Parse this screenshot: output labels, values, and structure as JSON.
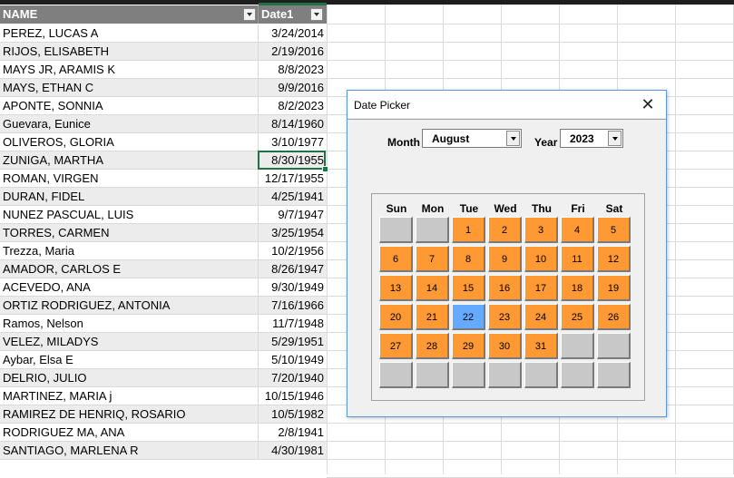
{
  "sheet": {
    "headers": {
      "name": "NAME",
      "date": "Date1"
    },
    "rows": [
      {
        "name": "PEREZ, LUCAS A",
        "date": "3/24/2014"
      },
      {
        "name": "RIJOS, ELISABETH",
        "date": "2/19/2016"
      },
      {
        "name": "MAYS JR, ARAMIS K",
        "date": "8/8/2023"
      },
      {
        "name": "MAYS, ETHAN C",
        "date": "9/9/2016"
      },
      {
        "name": "APONTE, SONNIA",
        "date": "8/2/2023"
      },
      {
        "name": "Guevara, Eunice",
        "date": "8/14/1960"
      },
      {
        "name": "OLIVEROS, GLORIA",
        "date": "3/10/1977"
      },
      {
        "name": "ZUNIGA, MARTHA",
        "date": "8/30/1955"
      },
      {
        "name": "ROMAN, VIRGEN",
        "date": "12/17/1955"
      },
      {
        "name": "DURAN, FIDEL",
        "date": "4/25/1941"
      },
      {
        "name": "NUNEZ PASCUAL, LUIS",
        "date": "9/7/1947"
      },
      {
        "name": "TORRES, CARMEN",
        "date": "3/25/1954"
      },
      {
        "name": "Trezza, Maria",
        "date": "10/2/1956"
      },
      {
        "name": "AMADOR, CARLOS E",
        "date": "8/26/1947"
      },
      {
        "name": "ACEVEDO, ANA",
        "date": "9/30/1949"
      },
      {
        "name": "ORTIZ RODRIGUEZ, ANTONIA",
        "date": "7/16/1966"
      },
      {
        "name": "Ramos, Nelson",
        "date": "11/7/1948"
      },
      {
        "name": "VELEZ, MILADYS",
        "date": "5/29/1951"
      },
      {
        "name": "Aybar, Elsa E",
        "date": "5/10/1949"
      },
      {
        "name": "DELRIO, JULIO",
        "date": "7/20/1940"
      },
      {
        "name": "MARTINEZ, MARIA j",
        "date": "10/15/1946"
      },
      {
        "name": "RAMIREZ DE HENRIQ, ROSARIO",
        "date": "10/5/1982"
      },
      {
        "name": "RODRIGUEZ MA, ANA",
        "date": "2/8/1941"
      },
      {
        "name": "SANTIAGO, MARLENA R",
        "date": "4/30/1981"
      }
    ],
    "selected_row": 7,
    "colors": {
      "header_bg": "#7f7f7f",
      "band": "#ececec",
      "selection": "#217346"
    }
  },
  "dialog": {
    "title": "Date Picker",
    "close_icon": "close-icon",
    "month_label": "Month",
    "month_value": "August",
    "year_label": "Year",
    "year_value": "2023",
    "weekdays": [
      "Sun",
      "Mon",
      "Tue",
      "Wed",
      "Thu",
      "Fri",
      "Sat"
    ],
    "weeks": [
      [
        "",
        "",
        "1",
        "2",
        "3",
        "4",
        "5"
      ],
      [
        "6",
        "7",
        "8",
        "9",
        "10",
        "11",
        "12"
      ],
      [
        "13",
        "14",
        "15",
        "16",
        "17",
        "18",
        "19"
      ],
      [
        "20",
        "21",
        "22",
        "23",
        "24",
        "25",
        "26"
      ],
      [
        "27",
        "28",
        "29",
        "30",
        "31",
        "",
        ""
      ],
      [
        "",
        "",
        "",
        "",
        "",
        "",
        ""
      ]
    ],
    "highlighted_day": "22",
    "colors": {
      "day": "#ff9933",
      "today": "#66aaff",
      "blank": "#c8c8c8"
    }
  }
}
